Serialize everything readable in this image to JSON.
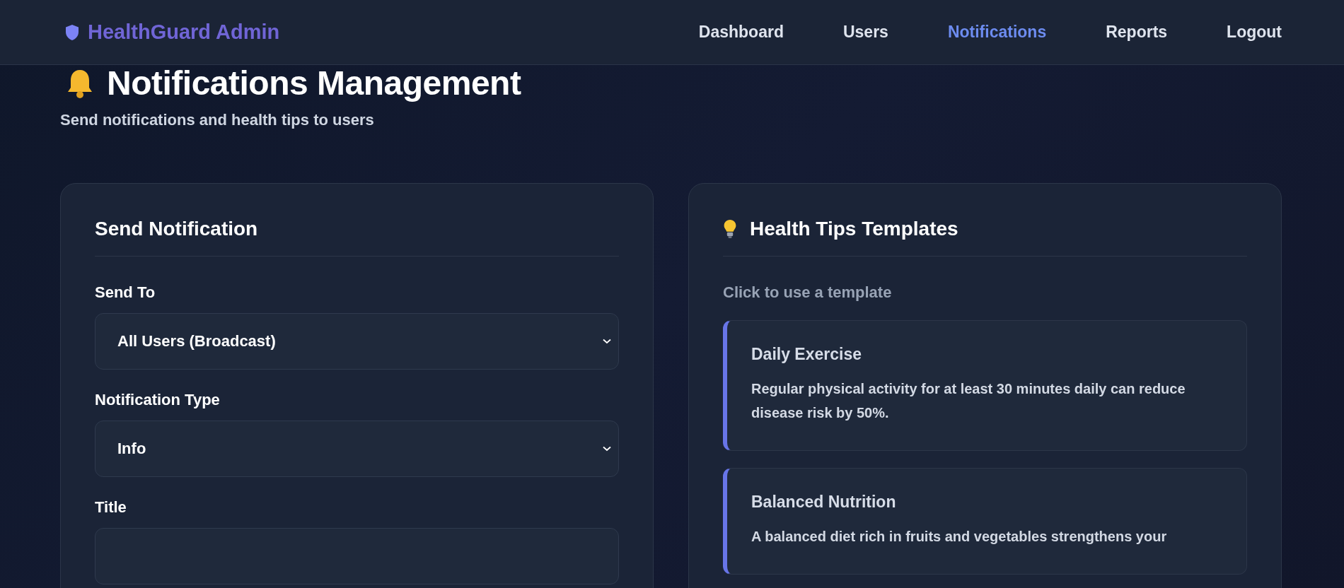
{
  "header": {
    "brand": "HealthGuard Admin",
    "nav": [
      {
        "label": "Dashboard",
        "selected": false
      },
      {
        "label": "Users",
        "selected": false
      },
      {
        "label": "Notifications",
        "selected": true
      },
      {
        "label": "Reports",
        "selected": false
      },
      {
        "label": "Logout",
        "selected": false
      }
    ]
  },
  "page": {
    "title": "Notifications Management",
    "subtitle": "Send notifications and health tips to users"
  },
  "send_card": {
    "title": "Send Notification",
    "fields": [
      {
        "label": "Send To",
        "kind": "select",
        "value": "All Users (Broadcast)"
      },
      {
        "label": "Notification Type",
        "kind": "select",
        "value": "Info"
      },
      {
        "label": "Title",
        "kind": "text"
      }
    ]
  },
  "tips_card": {
    "title": "Health Tips Templates",
    "hint": "Click to use a template",
    "templates": [
      {
        "title": "Daily Exercise",
        "text": "Regular physical activity for at least 30 minutes daily can reduce disease risk by 50%."
      },
      {
        "title": "Balanced Nutrition",
        "text": "A balanced diet rich in fruits and vegetables strengthens your"
      }
    ]
  }
}
